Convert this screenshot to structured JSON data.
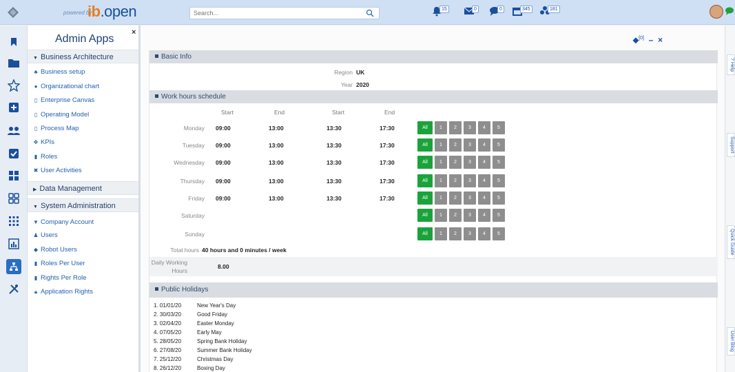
{
  "header": {
    "powered_by": "powered by",
    "brand_prefix": "ib",
    "brand_suffix": ".open",
    "search_placeholder": "Search...",
    "notifications": [
      {
        "icon": "bell-icon",
        "count": "15"
      },
      {
        "icon": "mail-icon",
        "count": "0"
      },
      {
        "icon": "chat-icon",
        "count": "0"
      },
      {
        "icon": "calendar-icon",
        "count": "345"
      },
      {
        "icon": "network-icon",
        "count": "181"
      }
    ],
    "colors": {
      "bar": "#cfe0f4",
      "brand": "#1a4f9a",
      "accent": "#e67e22"
    }
  },
  "sidebar": {
    "title": "Admin Apps",
    "close": "×",
    "rail_icons": [
      "bookmark-icon",
      "folder-icon",
      "star-icon",
      "plus-square-icon",
      "users-icon",
      "checkbox-icon",
      "grid-icon",
      "apps-icon",
      "dots-grid-icon",
      "chart-icon",
      "org-icon",
      "tools-icon"
    ],
    "sections": {
      "business": {
        "label": "Business Architecture",
        "items": [
          {
            "icon": "tree",
            "label": "Business setup"
          },
          {
            "icon": "group",
            "label": "Organizational chart"
          },
          {
            "icon": "clipboard",
            "label": "Enterprise Canvas"
          },
          {
            "icon": "clipboard",
            "label": "Operating Model"
          },
          {
            "icon": "clipboard",
            "label": "Process Map"
          },
          {
            "icon": "kpi",
            "label": "KPIs"
          },
          {
            "icon": "roles",
            "label": "Roles"
          },
          {
            "icon": "activity",
            "label": "User Activities"
          }
        ]
      },
      "data": {
        "label": "Data Management"
      },
      "system": {
        "label": "System Administration",
        "items": [
          {
            "icon": "pin",
            "label": "Company Account"
          },
          {
            "icon": "user",
            "label": "Users"
          },
          {
            "icon": "robot",
            "label": "Robot Users"
          },
          {
            "icon": "roles",
            "label": "Roles Per User"
          },
          {
            "icon": "roles",
            "label": "Rights Per Role"
          },
          {
            "icon": "lock",
            "label": "Application Rights"
          }
        ]
      }
    }
  },
  "main": {
    "tag_count": "[0]",
    "minimize": "–",
    "close": "×",
    "basic_info": {
      "title": "Basic Info",
      "region_label": "Region",
      "region": "UK",
      "year_label": "Year",
      "year": "2020"
    },
    "work_hours": {
      "title": "Work hours schedule",
      "col_headers": [
        "Start",
        "End",
        "Start",
        "End"
      ],
      "days": [
        {
          "name": "Monday",
          "times": [
            "09:00",
            "13:00",
            "13:30",
            "17:30"
          ]
        },
        {
          "name": "Tuesday",
          "times": [
            "09:00",
            "13:00",
            "13:30",
            "17:30"
          ]
        },
        {
          "name": "Wednesday",
          "times": [
            "09:00",
            "13:00",
            "13:30",
            "17:30"
          ]
        },
        {
          "name": "Thursday",
          "times": [
            "09:00",
            "13:00",
            "13:30",
            "17:30"
          ]
        },
        {
          "name": "Friday",
          "times": [
            "09:00",
            "13:00",
            "13:30",
            "17:30"
          ]
        },
        {
          "name": "Saturday",
          "times": [
            "",
            "",
            "",
            ""
          ]
        },
        {
          "name": "Sunday",
          "times": [
            "",
            "",
            "",
            ""
          ]
        }
      ],
      "buttons": [
        "All",
        "1",
        "2",
        "3",
        "4",
        "5"
      ],
      "total_label": "Total hours",
      "total_value": "40 hours and 0 minutes / week",
      "daily_label_1": "Daily Working",
      "daily_label_2": "Hours",
      "daily_value": "8.00"
    },
    "holidays": {
      "title": "Public Holidays",
      "items": [
        {
          "date": "1. 01/01/20",
          "name": "New Year's Day"
        },
        {
          "date": "2. 30/03/20",
          "name": "Good Friday"
        },
        {
          "date": "3. 02/04/20",
          "name": "Easter Monday"
        },
        {
          "date": "4. 07/05/20",
          "name": "Early May"
        },
        {
          "date": "5. 28/05/20",
          "name": "Spring Bank Holiday"
        },
        {
          "date": "6. 27/08/20",
          "name": "Summer Bank Holiday"
        },
        {
          "date": "7. 25/12/20",
          "name": "Christmas Day"
        },
        {
          "date": "8. 26/12/20",
          "name": "Boxing Day"
        }
      ]
    }
  },
  "right_tabs": [
    "? Help",
    "Support",
    "Quick Guide",
    "User Blog"
  ]
}
